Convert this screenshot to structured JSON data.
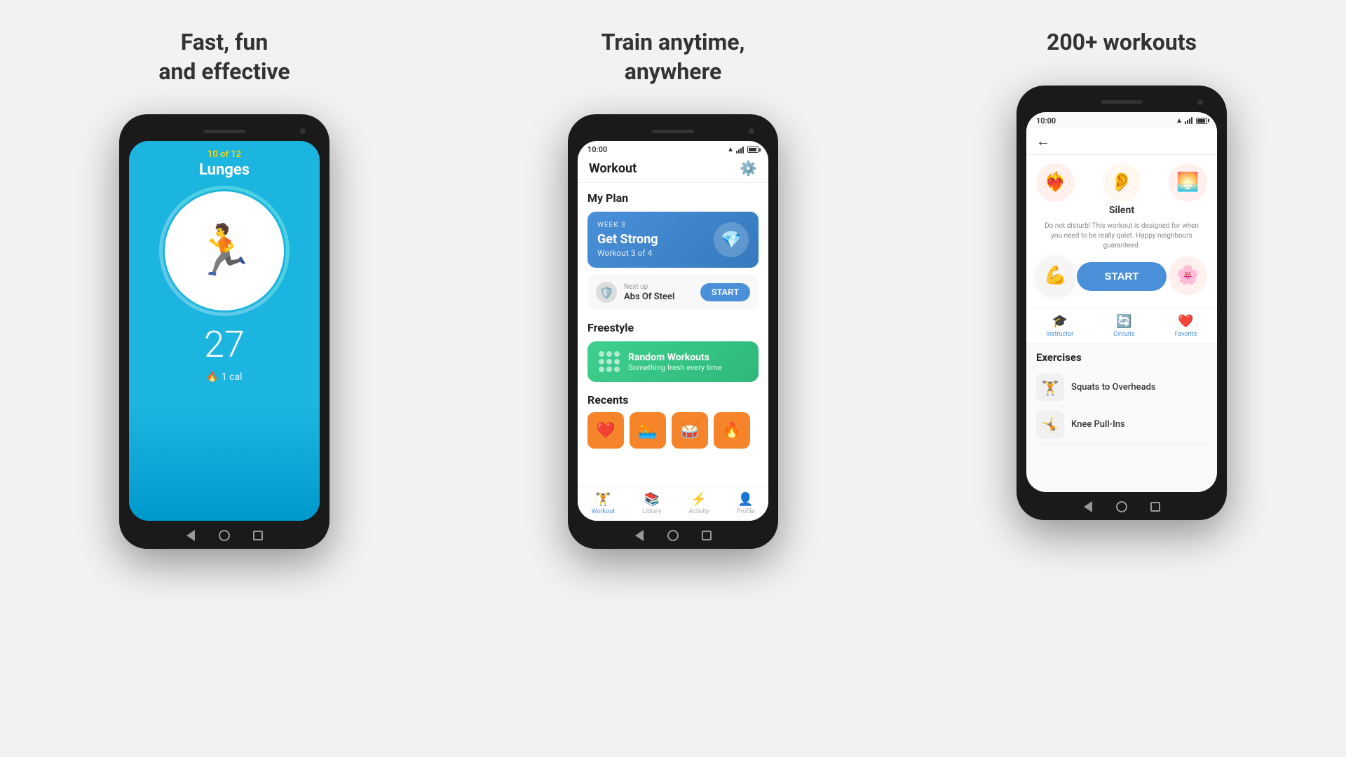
{
  "panels": [
    {
      "title": "Fast, fun\nand effective",
      "phone": {
        "screen_type": "workout",
        "rep_label": "10 of 12",
        "exercise": "Lunges",
        "timer": "27",
        "calories": "1 cal"
      }
    },
    {
      "title": "Train anytime,\nanywhere",
      "phone": {
        "screen_type": "plan",
        "time": "10:00",
        "header": "Workout",
        "section1": "My Plan",
        "plan_week": "WEEK 3",
        "plan_name": "Get Strong",
        "plan_progress": "Workout 3 of 4",
        "next_up_label": "Next up",
        "next_up_name": "Abs Of Steel",
        "start_label": "START",
        "section2": "Freestyle",
        "freestyle_title": "Random Workouts",
        "freestyle_subtitle": "Something fresh every time",
        "section3": "Recents",
        "nav_items": [
          "Workout",
          "Library",
          "Activity",
          "Profile"
        ],
        "nav_active": 0
      }
    },
    {
      "title": "200+ workouts",
      "phone": {
        "screen_type": "detail",
        "time": "10:00",
        "workout_title": "Silent",
        "workout_desc": "Do not disturb! This workout is designed for when you need to be really quiet. Happy neighbours guaranteed.",
        "start_label": "START",
        "tabs": [
          "Instructor",
          "Circuits",
          "Favorite"
        ],
        "exercises_title": "Exercises",
        "exercises": [
          "Squats to Overheads",
          "Knee Pull-Ins"
        ]
      }
    }
  ]
}
